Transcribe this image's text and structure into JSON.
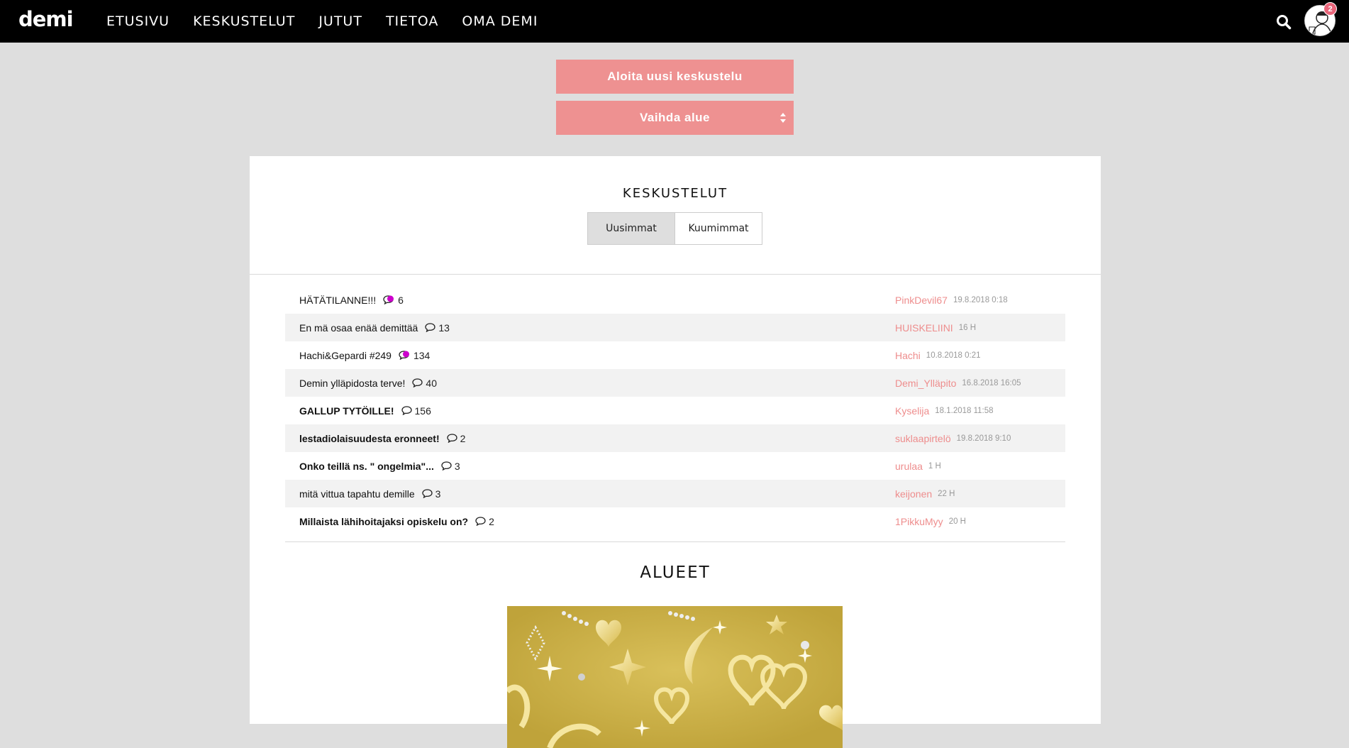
{
  "header": {
    "logo": "demi",
    "nav": [
      "ETUSIVU",
      "KESKUSTELUT",
      "JUTUT",
      "TIETOA",
      "OMA DEMI"
    ],
    "notification_count": "2"
  },
  "actions": {
    "new_discussion": "Aloita uusi keskustelu",
    "change_area": "Vaihda alue"
  },
  "discussions": {
    "title": "KESKUSTELUT",
    "tabs": [
      "Uusimmat",
      "Kuumimmat"
    ],
    "active_tab": "Uusimmat",
    "threads": [
      {
        "title": "HÄTÄTILANNE!!!",
        "bold": false,
        "comments": "6",
        "hot": true,
        "author": "PinkDevil67",
        "time": "19.8.2018 0:18"
      },
      {
        "title": "En mä osaa enää demittää",
        "bold": false,
        "comments": "13",
        "hot": false,
        "author": "HUISKELIINI",
        "time": "16 H"
      },
      {
        "title": "Hachi&Gepardi #249",
        "bold": false,
        "comments": "134",
        "hot": true,
        "author": "Hachi",
        "time": "10.8.2018 0:21"
      },
      {
        "title": "Demin ylläpidosta terve!",
        "bold": false,
        "comments": "40",
        "hot": false,
        "author": "Demi_Ylläpito",
        "time": "16.8.2018 16:05"
      },
      {
        "title": "GALLUP TYTÖILLE!",
        "bold": true,
        "comments": "156",
        "hot": false,
        "author": "Kyselija",
        "time": "18.1.2018 11:58"
      },
      {
        "title": "lestadiolaisuudesta eronneet!",
        "bold": true,
        "comments": "2",
        "hot": false,
        "author": "suklaapirtelö",
        "time": "19.8.2018 9:10"
      },
      {
        "title": "Onko teillä ns. \" ongelmia\"...",
        "bold": true,
        "comments": "3",
        "hot": false,
        "author": "urulaa",
        "time": "1 H"
      },
      {
        "title": "mitä vittua tapahtu demille",
        "bold": false,
        "comments": "3",
        "hot": false,
        "author": "keijonen",
        "time": "22 H"
      },
      {
        "title": "Millaista lähihoitajaksi opiskelu on?",
        "bold": true,
        "comments": "2",
        "hot": false,
        "author": "1PikkuMyy",
        "time": "20 H"
      }
    ]
  },
  "areas": {
    "title": "ALUEET"
  },
  "colors": {
    "accent": "#ee9191",
    "author": "#ee8d8d",
    "hot_bubble": "#cc00cc",
    "background": "#dedede"
  },
  "icons": {
    "search": "search-icon",
    "comment": "comment-bubble-icon",
    "sort": "sort-arrows-icon"
  }
}
